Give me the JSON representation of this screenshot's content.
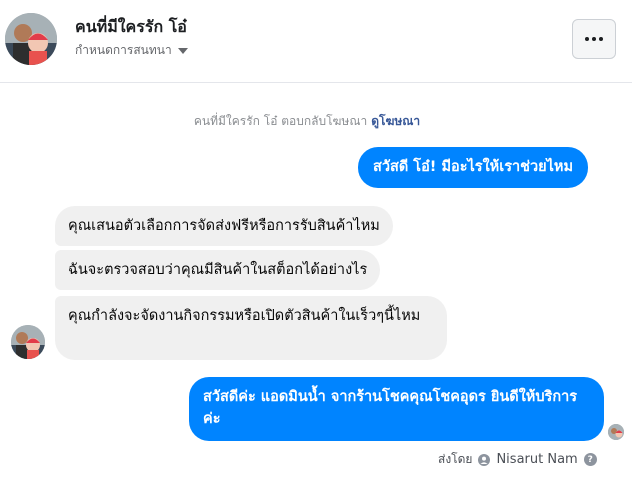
{
  "header": {
    "name": "คนที่มีใครรัก โอ๋",
    "subtitle": "กำหนดการสนทนา",
    "more_icon": "ellipsis-icon"
  },
  "notice": {
    "text": "คนที่มีใครรัก โอ๋ ตอบกลับโฆษณา",
    "link": "ดูโฆษณา"
  },
  "messages": [
    {
      "direction": "outgoing",
      "text": "สวัสดี โอ๋! มีอะไรให้เราช่วยไหม"
    },
    {
      "direction": "incoming",
      "text": "คุณเสนอตัวเลือกการจัดส่งฟรีหรือการรับสินค้าไหม"
    },
    {
      "direction": "incoming",
      "text": "ฉันจะตรวจสอบว่าคุณมีสินค้าในสต็อกได้อย่างไร"
    },
    {
      "direction": "incoming",
      "text": "คุณกำลังจะจัดงานกิจกรรมหรือเปิดตัวสินค้าในเร็วๆนี้ไหม"
    },
    {
      "direction": "outgoing",
      "text": "สวัสดีค่ะ แอดมินน้ำ จากร้านโชคคุณโชคอุดร ยินดีให้บริการค่ะ"
    }
  ],
  "sent_by": {
    "label": "ส่งโดย",
    "name": "Nisarut Nam",
    "help": "?"
  },
  "colors": {
    "outgoing_bubble": "#0084ff",
    "incoming_bubble": "#f0f0f0",
    "link": "#385898"
  }
}
